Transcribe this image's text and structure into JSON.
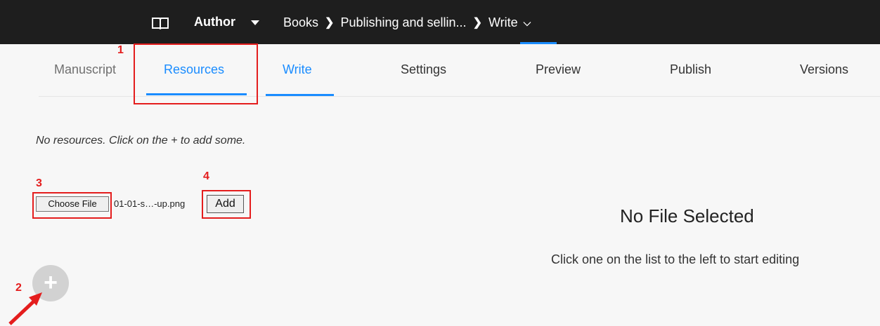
{
  "header": {
    "author_label": "Author",
    "breadcrumb": [
      "Books",
      "Publishing and sellin...",
      "Write"
    ],
    "icons": {
      "book": "book-icon",
      "caret": "caret-down-icon",
      "separator": "chevron-right-icon",
      "dropdown": "chevron-down-icon"
    }
  },
  "tabs": [
    {
      "label": "Manuscript"
    },
    {
      "label": "Resources"
    },
    {
      "label": "Write"
    },
    {
      "label": "Settings"
    },
    {
      "label": "Preview"
    },
    {
      "label": "Publish"
    },
    {
      "label": "Versions"
    }
  ],
  "resources": {
    "empty_text": "No resources. Click on the + to add some.",
    "choose_file_label": "Choose File",
    "file_name": "01-01-s…-up.png",
    "add_label": "Add",
    "plus_label": "+"
  },
  "annotations": {
    "labels": [
      "1",
      "2",
      "3",
      "4"
    ],
    "color": "#e41d1d"
  },
  "editor": {
    "title": "No File Selected",
    "hint": "Click one on the list to the left to start editing"
  },
  "colors": {
    "accent": "#1a8cff",
    "topbar": "#1e1e1e",
    "background": "#f7f7f7"
  }
}
